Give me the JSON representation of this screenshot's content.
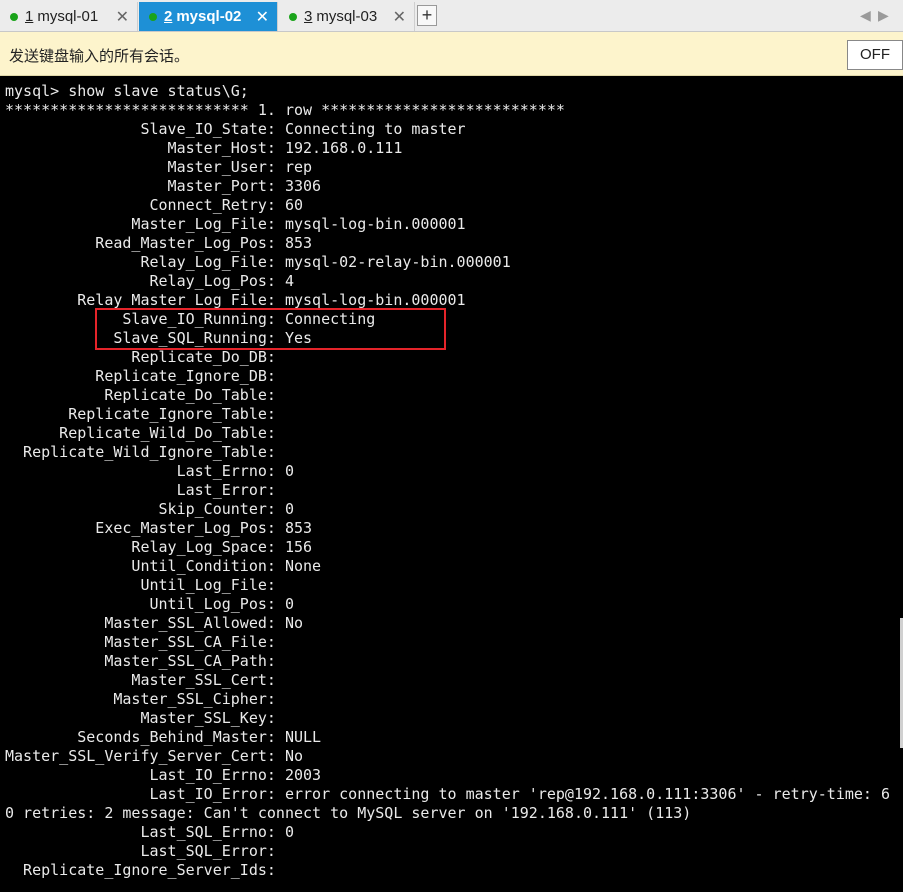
{
  "tabs": [
    {
      "number": "1",
      "label": "mysql-01",
      "active": false
    },
    {
      "number": "2",
      "label": "mysql-02",
      "active": true
    },
    {
      "number": "3",
      "label": "mysql-03",
      "active": false
    }
  ],
  "add_tab_label": "+",
  "nav": {
    "prev": "◀",
    "next": "▶"
  },
  "notice": {
    "text": "发送键盘输入的所有会话。",
    "off_label": "OFF"
  },
  "colors": {
    "tab_active": "#1e90d6",
    "status_dot": "#1aa31a",
    "highlight": "#e5242a",
    "notice_bg": "#fdf4cc"
  },
  "terminal": {
    "lines": [
      "mysql> show slave status\\G;",
      "*************************** 1. row ***************************",
      "               Slave_IO_State: Connecting to master",
      "                  Master_Host: 192.168.0.111",
      "                  Master_User: rep",
      "                  Master_Port: 3306",
      "                Connect_Retry: 60",
      "              Master_Log_File: mysql-log-bin.000001",
      "          Read_Master_Log_Pos: 853",
      "               Relay_Log_File: mysql-02-relay-bin.000001",
      "                Relay_Log_Pos: 4",
      "        Relay_Master_Log_File: mysql-log-bin.000001",
      "             Slave_IO_Running: Connecting",
      "            Slave_SQL_Running: Yes",
      "              Replicate_Do_DB: ",
      "          Replicate_Ignore_DB: ",
      "           Replicate_Do_Table: ",
      "       Replicate_Ignore_Table: ",
      "      Replicate_Wild_Do_Table: ",
      "  Replicate_Wild_Ignore_Table: ",
      "                   Last_Errno: 0",
      "                   Last_Error: ",
      "                 Skip_Counter: 0",
      "          Exec_Master_Log_Pos: 853",
      "              Relay_Log_Space: 156",
      "              Until_Condition: None",
      "               Until_Log_File: ",
      "                Until_Log_Pos: 0",
      "           Master_SSL_Allowed: No",
      "           Master_SSL_CA_File: ",
      "           Master_SSL_CA_Path: ",
      "              Master_SSL_Cert: ",
      "            Master_SSL_Cipher: ",
      "               Master_SSL_Key: ",
      "        Seconds_Behind_Master: NULL",
      "Master_SSL_Verify_Server_Cert: No",
      "                Last_IO_Errno: 2003",
      "                Last_IO_Error: error connecting to master 'rep@192.168.0.111:3306' - retry-time: 6",
      "0 retries: 2 message: Can't connect to MySQL server on '192.168.0.111' (113)",
      "               Last_SQL_Errno: 0",
      "               Last_SQL_Error: ",
      "  Replicate_Ignore_Server_Ids: "
    ]
  }
}
